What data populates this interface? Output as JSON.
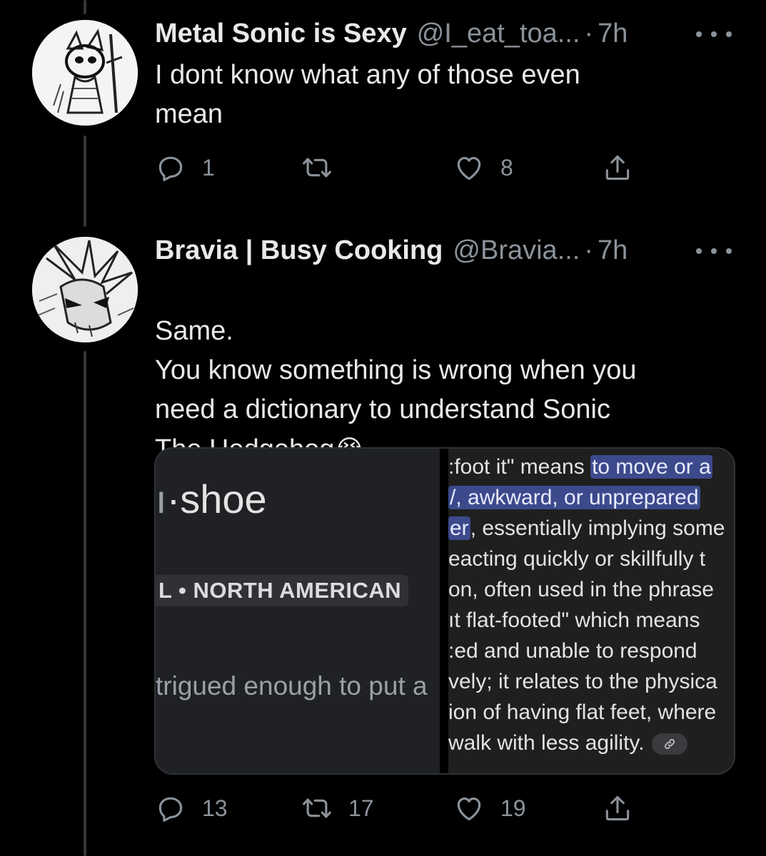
{
  "tweets": [
    {
      "display_name": "Metal Sonic is Sexy",
      "handle": "@I_eat_toa...",
      "separator": "·",
      "time": "7h",
      "text": "I dont know what any of those even\nmean",
      "reply_count": "1",
      "retweet_count": "",
      "like_count": "8",
      "avatar_icon": "metal-sonic-sketch-avatar"
    },
    {
      "display_name": "Bravia | Busy Cooking",
      "handle": "@Bravia...",
      "separator": "·",
      "time": "7h",
      "text": "Same.\nYou know something is wrong when you\nneed a dictionary to understand Sonic\nThe Hedgehog",
      "emoji": "😭",
      "reply_count": "13",
      "retweet_count": "17",
      "like_count": "19",
      "avatar_icon": "manga-character-avatar"
    }
  ],
  "media": {
    "left": {
      "word": "·shoe",
      "word_prefix": "ı",
      "region_label": "L • NORTH AMERICAN",
      "example": "trigued enough to put a"
    },
    "right": {
      "lines": [
        {
          "pre": ":foot it\" means ",
          "hl": "to move or a",
          "post": ""
        },
        {
          "pre": "",
          "hl": "/, awkward, or unprepared",
          "post": ""
        },
        {
          "pre": "",
          "hl": "er",
          "post": ", essentially implying some"
        },
        {
          "pre": "eacting quickly or skillfully t",
          "hl": "",
          "post": ""
        },
        {
          "pre": "on, often used in the phrase",
          "hl": "",
          "post": ""
        },
        {
          "pre": "ıt flat-footed\" which means",
          "hl": "",
          "post": ""
        },
        {
          "pre": ":ed and unable to respond",
          "hl": "",
          "post": ""
        },
        {
          "pre": "vely; it relates to the physica",
          "hl": "",
          "post": ""
        },
        {
          "pre": "ion of having flat feet, where",
          "hl": "",
          "post": ""
        },
        {
          "pre": "walk with less agility.",
          "hl": "",
          "post": ""
        }
      ],
      "link_icon": "link-icon"
    }
  },
  "colors": {
    "background": "#000000",
    "text": "#e7e9ea",
    "secondary": "#8b9299",
    "highlight": "#3c4a8c"
  }
}
